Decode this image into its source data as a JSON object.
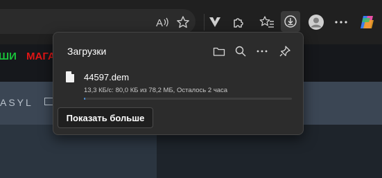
{
  "page": {
    "promo_green": "ШИ",
    "promo_red": "МАГА",
    "nav_text": "ASYL"
  },
  "toolbar": {
    "icons": [
      "read-aloud-icon",
      "favorite-star-icon",
      "vivaldi-v-icon",
      "extensions-icon",
      "favorites-list-icon",
      "downloads-icon",
      "profile-icon",
      "more-icon",
      "copilot-icon"
    ]
  },
  "downloads": {
    "title": "Загрузки",
    "item": {
      "filename": "44597.dem",
      "status": "13,3 КБ/с: 80,0 КБ из 78,2 МБ, Осталось 2 часа",
      "progress_fraction": 0.001
    },
    "show_more_label": "Показать больше"
  },
  "colors": {
    "promo_green": "#19c13a",
    "promo_red": "#e01515",
    "progress": "#4a8fd8"
  }
}
